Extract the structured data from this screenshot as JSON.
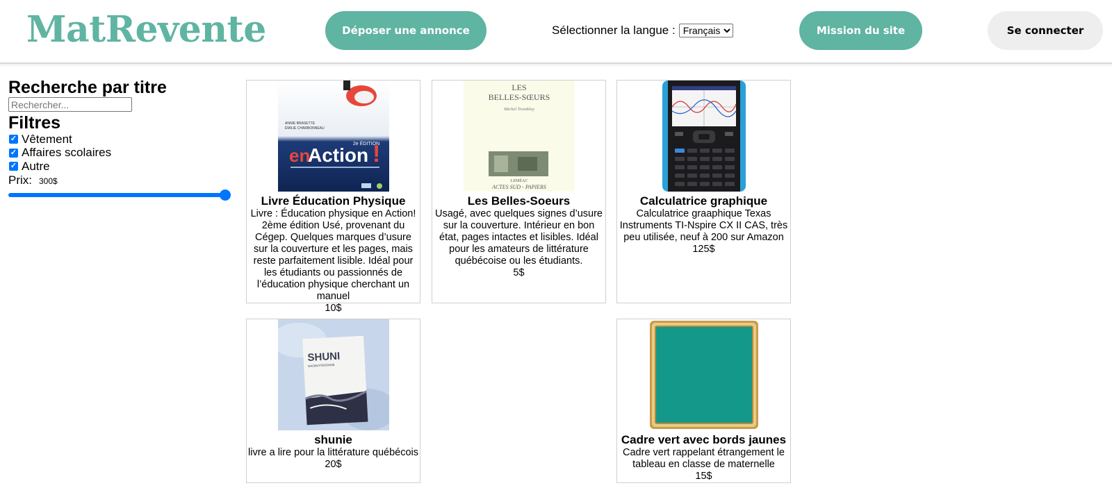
{
  "header": {
    "logo": "MatRevente",
    "deposer_label": "Déposer une annonce",
    "lang_label": "Sélectionner la langue :",
    "lang_selected": "Français",
    "mission_label": "Mission du site",
    "connect_label": "Se connecter"
  },
  "sidebar": {
    "search_title": "Recherche par titre",
    "search_placeholder": "Rechercher...",
    "filters_title": "Filtres",
    "filters": [
      {
        "label": "Vêtement",
        "checked": true
      },
      {
        "label": "Affaires scolaires",
        "checked": true
      },
      {
        "label": "Autre",
        "checked": true
      }
    ],
    "price_label": "Prix:",
    "price_value": "300$",
    "price_slider_fraction": 1.0
  },
  "listings": [
    {
      "title": "Livre Éducation Physique",
      "description": "Livre : Éducation physique en Action! 2ème édition Usé, provenant du Cégep. Quelques marques d’usure sur la couverture et les pages, mais reste parfaitement lisible. Idéal pour les étudiants ou passionnés de l’éducation physique cherchant un manuel",
      "price": "10$",
      "image": {
        "icon": "book-cover-en-action",
        "edition": "2e ÉDITION",
        "word1": "en",
        "word2": "Action",
        "exclaim": "!"
      }
    },
    {
      "title": "Les Belles-Soeurs",
      "description": "Usagé, avec quelques signes d’usure sur la couverture. Intérieur en bon état, pages intactes et lisibles. Idéal pour les amateurs de littérature québécoise ou les étudiants.",
      "price": "5$",
      "image": {
        "icon": "book-cover-belles-soeurs",
        "line1": "LES",
        "line2": "BELLES-SŒURS",
        "author": "Michel Tremblay",
        "publisher": "LEMÉAC",
        "series": "ACTES SUD - PAPIERS"
      }
    },
    {
      "title": "Calculatrice graphique",
      "description": "Calculatrice graaphique Texas Instruments TI-Nspire CX II CAS, très peu utilisée, neuf à 200 sur Amazon",
      "price": "125$",
      "image": {
        "icon": "graphing-calculator"
      }
    },
    {
      "title": "shunie",
      "description": "livre a lire pour la littérature québécois",
      "price": "20$",
      "image": {
        "icon": "book-photo-shuni",
        "book_title": "SHUNI",
        "book_author": "NAOMI FONTAINE"
      }
    },
    {
      "title": "Cadre vert avec bords jaunes",
      "description": "Cadre vert rappelant étrangement le tableau en classe de maternelle",
      "price": "15$",
      "image": {
        "icon": "green-frame-gold-border"
      }
    }
  ],
  "colors": {
    "brand": "#5fb4a2",
    "accent_blue": "#0075ff"
  }
}
